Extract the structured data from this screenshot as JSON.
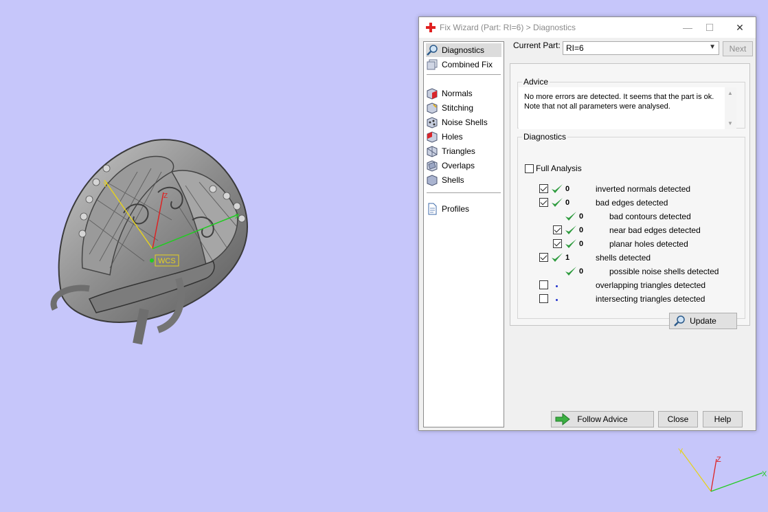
{
  "dialog": {
    "title": "Fix Wizard (Part: RI=6) > Diagnostics",
    "controls": {
      "minimize": "—",
      "maximize": "☐",
      "close": "✕"
    }
  },
  "nav": {
    "items": [
      {
        "label": "Diagnostics",
        "icon": "magnifier-icon",
        "selected": true
      },
      {
        "label": "Combined Fix",
        "icon": "stack-icon",
        "selected": false
      },
      {
        "label": "Normals",
        "icon": "normals-cube-icon",
        "selected": false
      },
      {
        "label": "Stitching",
        "icon": "stitching-cube-icon",
        "selected": false
      },
      {
        "label": "Noise Shells",
        "icon": "noise-shells-icon",
        "selected": false
      },
      {
        "label": "Holes",
        "icon": "holes-cube-icon",
        "selected": false
      },
      {
        "label": "Triangles",
        "icon": "triangles-cube-icon",
        "selected": false
      },
      {
        "label": "Overlaps",
        "icon": "overlaps-cube-icon",
        "selected": false
      },
      {
        "label": "Shells",
        "icon": "shells-cube-icon",
        "selected": false
      },
      {
        "label": "Profiles",
        "icon": "document-icon",
        "selected": false
      }
    ]
  },
  "current_part": {
    "label": "Current Part:",
    "value": "RI=6"
  },
  "next_label": "Next",
  "advice": {
    "label": "Advice",
    "text": "No more errors are detected. It seems that the part is ok. Note that not all parameters were analysed."
  },
  "diagnostics": {
    "label": "Diagnostics",
    "full_analysis_label": "Full Analysis",
    "full_analysis_checked": false,
    "rows": [
      {
        "checked": true,
        "status": "ok",
        "count": "0",
        "label": "inverted normals detected"
      },
      {
        "checked": true,
        "status": "ok",
        "count": "0",
        "label": "bad edges detected"
      },
      {
        "checked": null,
        "status": "ok",
        "count": "0",
        "label": "bad contours detected"
      },
      {
        "checked": true,
        "status": "ok",
        "count": "0",
        "label": "near bad edges detected"
      },
      {
        "checked": true,
        "status": "ok",
        "count": "0",
        "label": "planar holes detected"
      },
      {
        "checked": true,
        "status": "ok",
        "count": "1",
        "label": "shells detected"
      },
      {
        "checked": null,
        "status": "ok",
        "count": "0",
        "label": "possible noise shells detected"
      },
      {
        "checked": false,
        "status": "pending",
        "count": "",
        "label": "overlapping triangles detected"
      },
      {
        "checked": false,
        "status": "pending",
        "count": "",
        "label": "intersecting triangles detected"
      }
    ],
    "update_label": "Update"
  },
  "footer": {
    "follow_advice_label": "Follow Advice",
    "close_label": "Close",
    "help_label": "Help"
  },
  "viewport": {
    "background": "#c6c6fa",
    "wcs_label": "WCS",
    "axis_labels": {
      "x": "X",
      "y": "Y",
      "z": "Z"
    }
  },
  "colors": {
    "check_green": "#2e9b3e",
    "close_red": "#e02020",
    "axis_x": "#22cc22",
    "axis_y": "#e6d21e",
    "axis_z": "#dd2222",
    "pending_dot": "#2233cc"
  }
}
